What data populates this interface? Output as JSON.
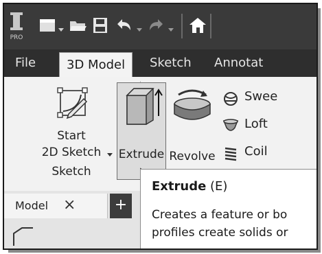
{
  "quick_access": {
    "pro_label": "PRO",
    "icons": [
      "inventor-logo-icon",
      "new-file-icon",
      "dropdown-arrow-icon",
      "open-folder-icon",
      "save-icon",
      "undo-icon",
      "dropdown-arrow-icon",
      "redo-icon",
      "dropdown-arrow-icon",
      "home-icon"
    ]
  },
  "tabs": [
    {
      "label": "File",
      "active": false
    },
    {
      "label": "3D Model",
      "active": true
    },
    {
      "label": "Sketch",
      "active": false
    },
    {
      "label": "Annotat",
      "active": false
    }
  ],
  "ribbon": {
    "start_sketch": {
      "line1": "Start",
      "line2": "2D Sketch",
      "icon": "start-2d-sketch-icon"
    },
    "panel_label": "Sketch",
    "extrude": {
      "label": "Extrude",
      "icon": "extrude-icon",
      "highlighted": true
    },
    "revolve": {
      "label": "Revolve",
      "icon": "revolve-icon"
    },
    "sweep": {
      "label": "Swee",
      "icon": "sweep-icon"
    },
    "loft": {
      "label": "Loft",
      "icon": "loft-icon"
    },
    "coil": {
      "label": "Coil",
      "icon": "coil-icon"
    }
  },
  "browser": {
    "model_tab_label": "Model",
    "close_glyph": "×",
    "add_glyph": "+"
  },
  "tooltip": {
    "title_bold": "Extrude",
    "title_rest": " (E)",
    "line1": "Creates a feature or bo",
    "line2": "profiles create solids or"
  },
  "colors": {
    "title_bar": "#3a3a3a",
    "tab_strip": "#2e2e2e",
    "ribbon_bg": "#f2f2f2",
    "highlight": "#dcdcdc"
  }
}
